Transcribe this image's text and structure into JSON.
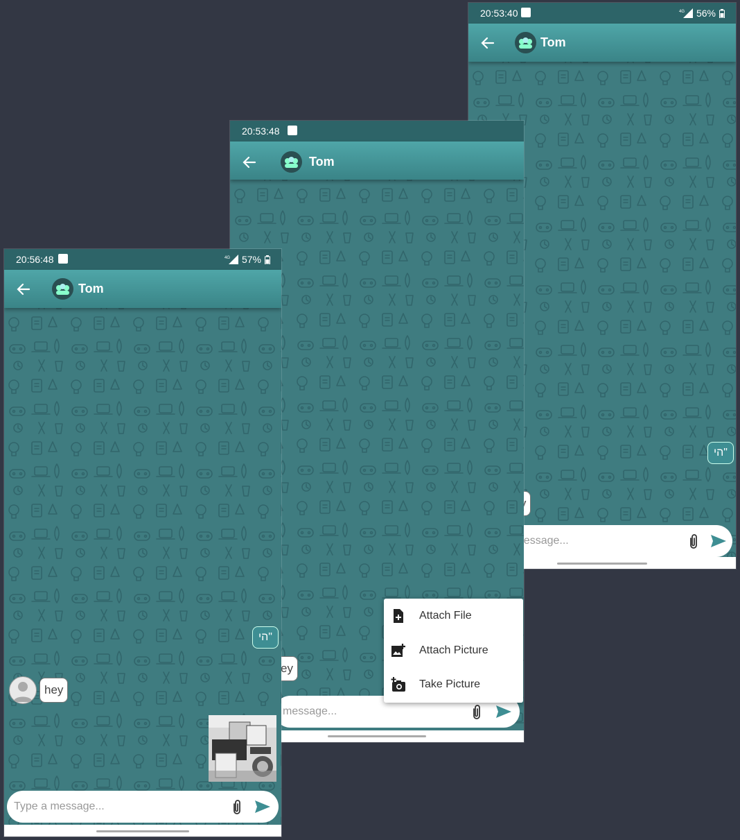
{
  "screens": {
    "left": {
      "status": {
        "time": "20:56:48",
        "network": "4G",
        "battery": "57%"
      },
      "header": {
        "contact": "Tom"
      },
      "messages": {
        "incoming": "hey",
        "outgoing": "הי\""
      },
      "image_message": {
        "label": "robot-photo"
      },
      "input": {
        "placeholder": "Type a message..."
      }
    },
    "middle": {
      "status": {
        "time": "20:53:48"
      },
      "header": {
        "contact": "Tom"
      },
      "messages": {
        "incoming_partial": "ey"
      },
      "input": {
        "placeholder_partial": "message..."
      },
      "attach_menu": {
        "items": [
          {
            "label": "Attach File",
            "icon": "file-plus-icon"
          },
          {
            "label": "Attach Picture",
            "icon": "image-plus-icon"
          },
          {
            "label": "Take Picture",
            "icon": "camera-plus-icon"
          }
        ]
      }
    },
    "right": {
      "status": {
        "time": "20:53:40",
        "network": "4G",
        "battery": "56%"
      },
      "header": {
        "contact": "Tom"
      },
      "messages": {
        "incoming": "hey",
        "outgoing": "הי\""
      },
      "input": {
        "placeholder": "Type a message..."
      }
    }
  },
  "colors": {
    "background": "#333744",
    "wallpaper": "#3f7c80",
    "appbar": "#4fa6a8",
    "statusbar": "#2d6468",
    "send": "#3e8e93"
  }
}
